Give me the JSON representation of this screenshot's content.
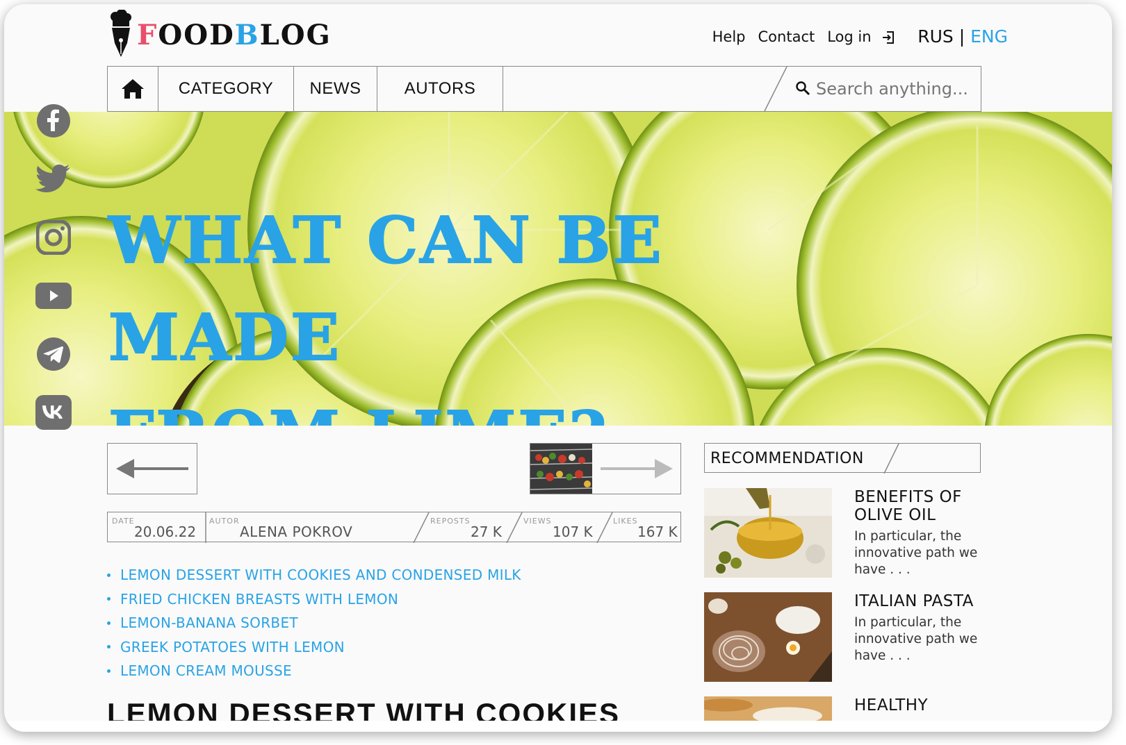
{
  "brand": {
    "logo_part1": "F",
    "logo_part2": "OOD",
    "logo_part3": "B",
    "logo_part4": "LOG"
  },
  "header": {
    "help": "Help",
    "contact": "Contact",
    "login": "Log in",
    "lang_rus": "RUS",
    "lang_sep": "|",
    "lang_eng": "ENG"
  },
  "nav": {
    "home_icon": "home-icon",
    "items": [
      {
        "label": "CATEGORY"
      },
      {
        "label": "NEWS"
      },
      {
        "label": "AUTORS"
      }
    ],
    "search_placeholder": "Search anything..."
  },
  "hero": {
    "title_line1": "What can be made",
    "title_line2": "from lime?"
  },
  "social": [
    "facebook-icon",
    "twitter-icon",
    "instagram-icon",
    "youtube-icon",
    "telegram-icon",
    "vk-icon"
  ],
  "meta": {
    "date_label": "DATE",
    "date": "20.06.22",
    "author_label": "AUTOR",
    "author": "ALENA POKROV",
    "reposts_label": "REPOSTS",
    "reposts": "27 K",
    "views_label": "VIEWS",
    "views": "107 K",
    "likes_label": "LIKES",
    "likes": "167 K"
  },
  "recipes": [
    "LEMON DESSERT WITH COOKIES AND CONDENSED MILK",
    "FRIED CHICKEN BREASTS WITH LEMON",
    "LEMON-BANANA SORBET",
    "GREEK POTATOES WITH LEMON",
    "LEMON CREAM MOUSSE"
  ],
  "article_heading": "LEMON DESSERT WITH COOKIES",
  "recommendation": {
    "title": "RECOMMENDATION",
    "items": [
      {
        "heading": "BENEFITS OF OLIVE OIL",
        "desc": "In particular, the innovative path we have . . ."
      },
      {
        "heading": "ITALIAN PASTA",
        "desc": "In particular, the innovative path we have . . ."
      },
      {
        "heading": "HEALTHY",
        "desc": ""
      }
    ]
  },
  "colors": {
    "accent": "#29a3e6",
    "logo_pink": "#e94e6a",
    "lime": "#dfe86a"
  }
}
